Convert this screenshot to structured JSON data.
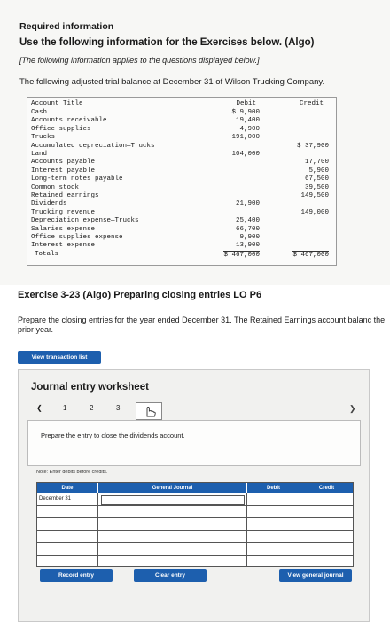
{
  "header": {
    "required": "Required information",
    "use": "Use the following information for the Exercises below. (Algo)",
    "italic": "[The following information applies to the questions displayed below.]",
    "intro": "The following adjusted trial balance at December 31 of Wilson Trucking Company."
  },
  "trial_balance": {
    "col_account": "Account Title",
    "col_debit": "Debit",
    "col_credit": "Credit",
    "rows": [
      {
        "account": "Cash",
        "debit": "$ 9,900",
        "credit": ""
      },
      {
        "account": "Accounts receivable",
        "debit": "19,400",
        "credit": ""
      },
      {
        "account": "Office supplies",
        "debit": "4,900",
        "credit": ""
      },
      {
        "account": "Trucks",
        "debit": "191,000",
        "credit": ""
      },
      {
        "account": "Accumulated depreciation—Trucks",
        "debit": "",
        "credit": "$ 37,900"
      },
      {
        "account": "Land",
        "debit": "104,000",
        "credit": ""
      },
      {
        "account": "Accounts payable",
        "debit": "",
        "credit": "17,700"
      },
      {
        "account": "Interest payable",
        "debit": "",
        "credit": "5,900"
      },
      {
        "account": "Long-term notes payable",
        "debit": "",
        "credit": "67,500"
      },
      {
        "account": "Common stock",
        "debit": "",
        "credit": "39,500"
      },
      {
        "account": "Retained earnings",
        "debit": "",
        "credit": "149,500"
      },
      {
        "account": "Dividends",
        "debit": "21,900",
        "credit": ""
      },
      {
        "account": "Trucking revenue",
        "debit": "",
        "credit": "149,000"
      },
      {
        "account": "Depreciation expense—Trucks",
        "debit": "25,400",
        "credit": ""
      },
      {
        "account": "Salaries expense",
        "debit": "66,700",
        "credit": ""
      },
      {
        "account": "Office supplies expense",
        "debit": "9,900",
        "credit": ""
      },
      {
        "account": "Interest expense",
        "debit": "13,900",
        "credit": ""
      },
      {
        "account": "Totals",
        "debit": "$ 467,000",
        "credit": "$ 467,000"
      }
    ]
  },
  "exercise": {
    "title": "Exercise 3-23 (Algo) Preparing closing entries LO P6",
    "prompt": "Prepare the closing entries for the year ended December 31. The Retained Earnings account balanc the prior year.",
    "view_transaction_label": "View transaction list"
  },
  "worksheet": {
    "title": "Journal entry worksheet",
    "pages": [
      "1",
      "2",
      "3"
    ],
    "instruction": "Prepare the entry to close the dividends account.",
    "note": "Note: Enter debits before credits.",
    "col_date": "Date",
    "col_journal": "General Journal",
    "col_debit": "Debit",
    "col_credit": "Credit",
    "date_value": "December 31",
    "record_label": "Record entry",
    "clear_label": "Clear entry",
    "view_journal_label": "View general journal"
  },
  "colors": {
    "accent": "#1d5fae"
  }
}
